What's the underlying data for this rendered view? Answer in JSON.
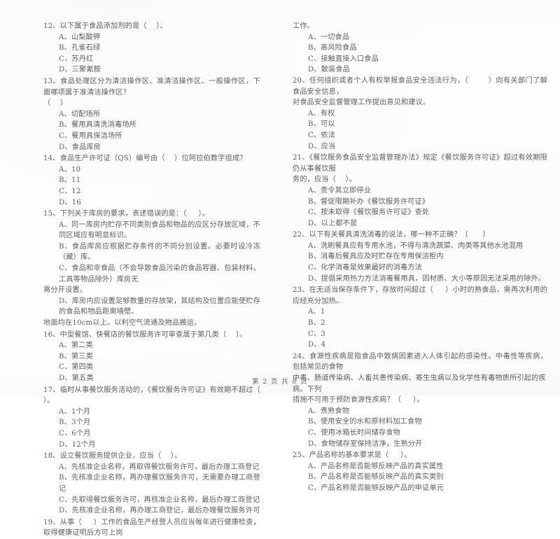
{
  "document": {
    "type": "exam-paper",
    "language": "zh-CN",
    "footer": "第 2 页 共 8 页"
  },
  "left_column": {
    "questions": [
      {
        "number": "12",
        "stem": "12、以下属于食品添加剂的是（    ）。",
        "options": [
          "A、山梨酸钾",
          "B、孔雀石绿",
          "C、苏丹红",
          "D、三聚氰胺"
        ]
      },
      {
        "number": "13",
        "stem": "13、食品处理区分为清洁操作区、准清洁操作区、一般操作区，下面哪项属于准清洁操作区？",
        "stem_cont": "（    ）",
        "options": [
          "A、切配场所",
          "B、餐用具清洗消毒场所",
          "C、餐用具保洁场所",
          "D、食品库房"
        ]
      },
      {
        "number": "14",
        "stem": "14、食品生产许可证（QS）编号由（    ）位阿拉伯数字组成？",
        "options": [
          "A、10",
          "B、11",
          "C、12",
          "D、16"
        ]
      },
      {
        "number": "15",
        "stem": "15、下列关于库房的要求，表述错误的是：（     ）。",
        "options": [
          "A、同一库房内贮存不同类别食品和物品的应区分存放区域，不同区域应有明显标识。",
          "B、食品库房应根据贮存条件的不同分别设置。必要时设冷冻（藏）库。",
          "C、食品和非食品（不会导致食品污染的食品容器、包装材料、工具等物品除外）库房无",
          "D、库房内应设置足够数量的存放架，其结构及位置应能使贮存的食品和物品距离墙壁、"
        ],
        "option_c_cont": "需分开设置。",
        "option_d_cont": "地面均在10cm以上。以利空气流通及物品搬运。"
      },
      {
        "number": "16",
        "stem": "16、中型餐馆、快餐店的餐饮服务许可审查属于第几类（    ）。",
        "options": [
          "A、第二类",
          "B、第三类",
          "C、第四类",
          "D、第五类"
        ]
      },
      {
        "number": "17",
        "stem": "17、临时从事餐饮服务活动的，《餐饮服务许可证》有效期不超过（    ）。",
        "options": [
          "A、1个月",
          "B、3个月",
          "C、6个月",
          "D、12个月"
        ]
      },
      {
        "number": "18",
        "stem": "18、设立餐饮服务提供企业，应当（    ）。",
        "options": [
          "A、先核准企业名称，再取得餐饮服务许可，最后办理工商登记",
          "B、先核准企业名称，再办理餐饮服务许可，无需要办理工商登记",
          "C、先取得餐饮服务许可，再核准企业名称，最后办理工商登记",
          "D、先核准企业名称，再办理工商登记，最后办理餐饮服务许可"
        ]
      },
      {
        "number": "19",
        "stem": "19、从事（     ）工作的食品生产经营人员应当每年进行健康检查，取得健康证明后方可上岗"
      }
    ]
  },
  "right_column": {
    "carryover": "工作。",
    "questions": [
      {
        "number": "19-options",
        "options": [
          "A、一切食品",
          "B、高风险食品",
          "C、接触直接入口食品",
          "D、散装食品"
        ]
      },
      {
        "number": "20",
        "stem": "20、任何组织或者个人有权举报食品安全违法行为，（        ）向有关部门了解食品安全信息，",
        "stem_cont": "对食品安全监督管理工作提出意见和建议。",
        "options": [
          "A、有权",
          "B、可以",
          "C、依法",
          "D、应当"
        ]
      },
      {
        "number": "21",
        "stem": "21、《餐饮服务食品安全监督管理办法》规定《餐饮服务许可证》超过有效期限仍从事餐饮服",
        "stem_cont": "务的，应当（    ）。",
        "options": [
          "A、责令其立即停业",
          "B、督促限期补办《餐饮服务许可证》",
          "C、按未取得《餐饮服务许可证》查处",
          "D、以上都不是"
        ]
      },
      {
        "number": "22",
        "stem": "22、以下有关餐具清洗消毒的说法，哪一种不正确？（      ）",
        "options": [
          "A、洗刷餐具应有专用水池，不得与清洗蔬菜、肉类等其他水池混用",
          "B、消毒后餐具应及时贮存在专用保洁柜内",
          "C、化学消毒是效果最好的消毒方法",
          "D、提倡采用热力方法消毒餐用具，因材质、大小等原因无法采用的除外。"
        ]
      },
      {
        "number": "23",
        "stem": "23、在无适当保存条件下，存放时间超过（     ）小时的熟食品，需再次利用的应经充分加热。",
        "options": [
          "A、1",
          "B、2",
          "C、3",
          "D、4"
        ]
      },
      {
        "number": "24",
        "stem": "24、食源性疾病是指食品中致病因素进入人体引起的感染性、中毒性等疾病，包括常见的食物",
        "stem_cont": "中毒、肠道传染病、人畜共患传染病、寄生虫病以及化学性有毒物质所引起的疾病。下列",
        "stem_cont2": "措施不可用于预防食源性疾病？（     ）。",
        "options": [
          "A、煮熟食物",
          "B、使用安全的水和原材料加工食物",
          "C、使用冰箱长时间储存食物",
          "D、食物储存室保持洁净，生熟分开"
        ]
      },
      {
        "number": "25",
        "stem": "25、产品名称的基本要求是（     ）。",
        "options": [
          "A、产品名称是否能够反映产品的真实属性",
          "B、产品名称是否能够反映产品的真实类别",
          "C、产品名称是否能够反映产品的申证单元"
        ]
      }
    ]
  }
}
